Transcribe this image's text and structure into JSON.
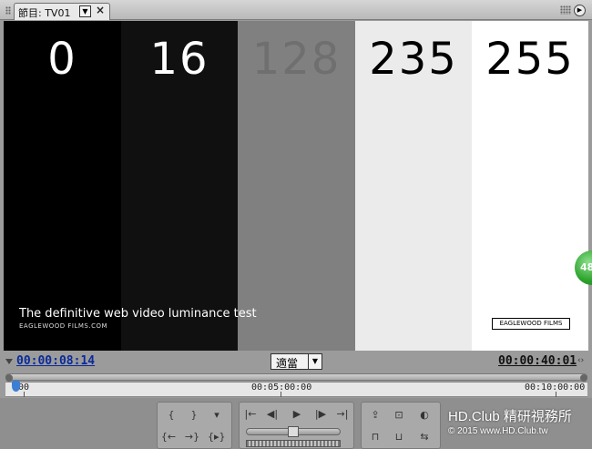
{
  "window": {
    "tab_title": "節目: TV01",
    "tab_dropdown": "▼",
    "tab_close": "×",
    "menu_icon": "▶"
  },
  "video": {
    "bars": [
      {
        "label": "0",
        "bg": "#000000",
        "fg": "#ffffff"
      },
      {
        "label": "16",
        "bg": "#101010",
        "fg": "#ffffff"
      },
      {
        "label": "128",
        "bg": "#808080",
        "fg": "#6f6f6f"
      },
      {
        "label": "235",
        "bg": "#ebebeb",
        "fg": "#000000"
      },
      {
        "label": "255",
        "bg": "#ffffff",
        "fg": "#000000"
      }
    ],
    "caption": "The definitive web video luminance test",
    "caption_sub": "EAGLEWOOD FILMS.COM",
    "logo_box": "EAGLEWOOD FILMS"
  },
  "badge": {
    "label": "48"
  },
  "timecode": {
    "current": "00:00:08:14",
    "fit": "適當",
    "fit_arrow": "▼",
    "duration": "00:00:40:01",
    "duration_icon": "‹›"
  },
  "ruler": {
    "labels": [
      ":00",
      "00:05:00:00",
      "00:10:00:00"
    ]
  },
  "controls": {
    "left_group": [
      "{",
      "}",
      "▾",
      "{←",
      "→}",
      "{▸}"
    ],
    "middle_top": [
      "|←",
      "◀|",
      "▶",
      "|▶",
      "→|"
    ],
    "right_group": [
      "⇪",
      "⊡",
      "◐",
      "⊓",
      "⊔",
      "⇆"
    ]
  },
  "watermark": {
    "line1": "HD.Club 精研視務所",
    "line2": "© 2015  www.HD.Club.tw"
  }
}
